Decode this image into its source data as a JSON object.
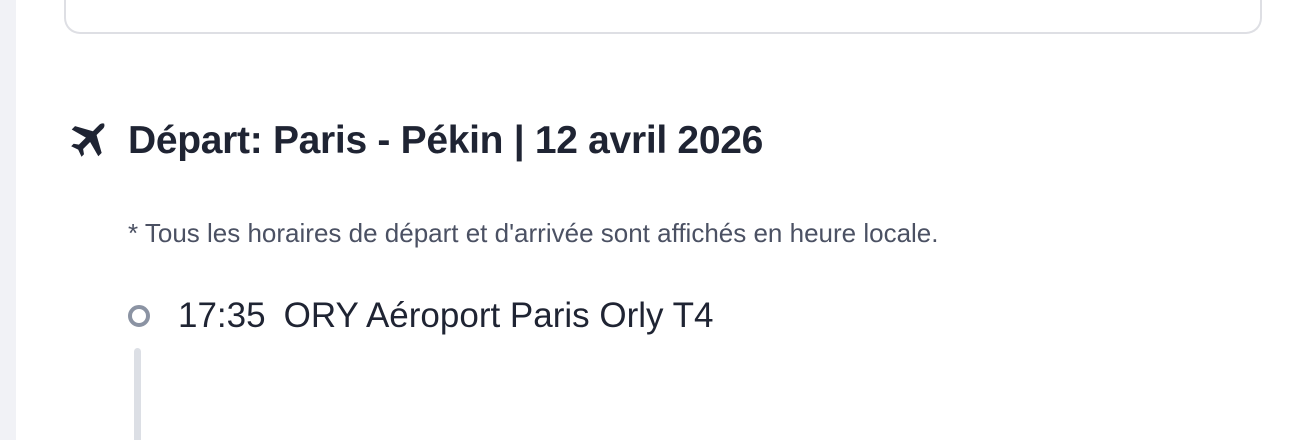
{
  "flight": {
    "icon": "plane-icon",
    "title": "Départ: Paris - Pékin | 12 avril 2026",
    "note": "* Tous les horaires de départ et d'arrivée sont affichés en heure locale.",
    "stops": [
      {
        "time": "17:35",
        "airport": "ORY Aéroport Paris Orly T4"
      }
    ]
  },
  "colors": {
    "text": "#1f2433",
    "muted": "#4b5163",
    "timeline": "#dcdfe5",
    "dot": "#8b93a3"
  }
}
